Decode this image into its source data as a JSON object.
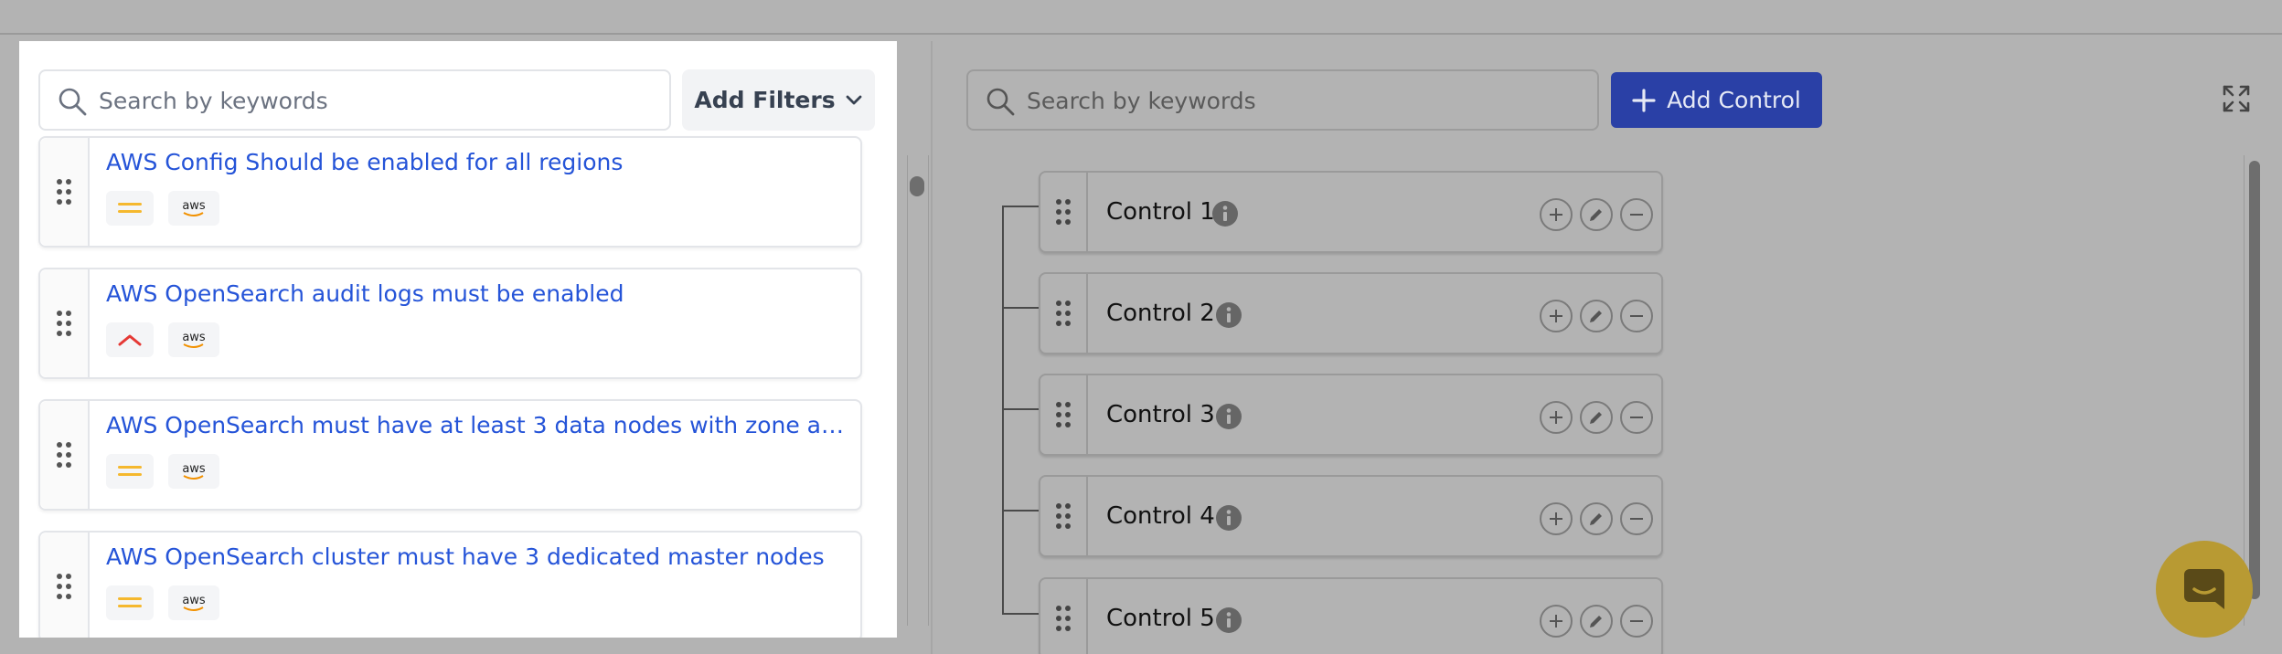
{
  "library": {
    "search_placeholder": "Search by keywords",
    "filters_label": "Add Filters",
    "items": [
      {
        "title": "AWS Config Should be enabled for all regions",
        "severity": "medium",
        "provider": "aws"
      },
      {
        "title": "AWS OpenSearch audit logs must be enabled",
        "severity": "high",
        "provider": "aws"
      },
      {
        "title": "AWS OpenSearch must have at least 3 data nodes with zone awar...",
        "severity": "medium",
        "provider": "aws"
      },
      {
        "title": "AWS OpenSearch cluster must have 3 dedicated master nodes",
        "severity": "medium",
        "provider": "aws"
      }
    ]
  },
  "controls": {
    "search_placeholder": "Search by keywords",
    "add_label": "Add Control",
    "items": [
      {
        "name": "Control 1"
      },
      {
        "name": "Control 2"
      },
      {
        "name": "Control 3"
      },
      {
        "name": "Control 4"
      },
      {
        "name": "Control 5"
      }
    ]
  },
  "colors": {
    "link_blue": "#2554d8",
    "add_button": "#2a40a6",
    "severity_medium": "#f5b82e",
    "severity_high": "#e53935",
    "chat_bubble": "#b89a33"
  }
}
